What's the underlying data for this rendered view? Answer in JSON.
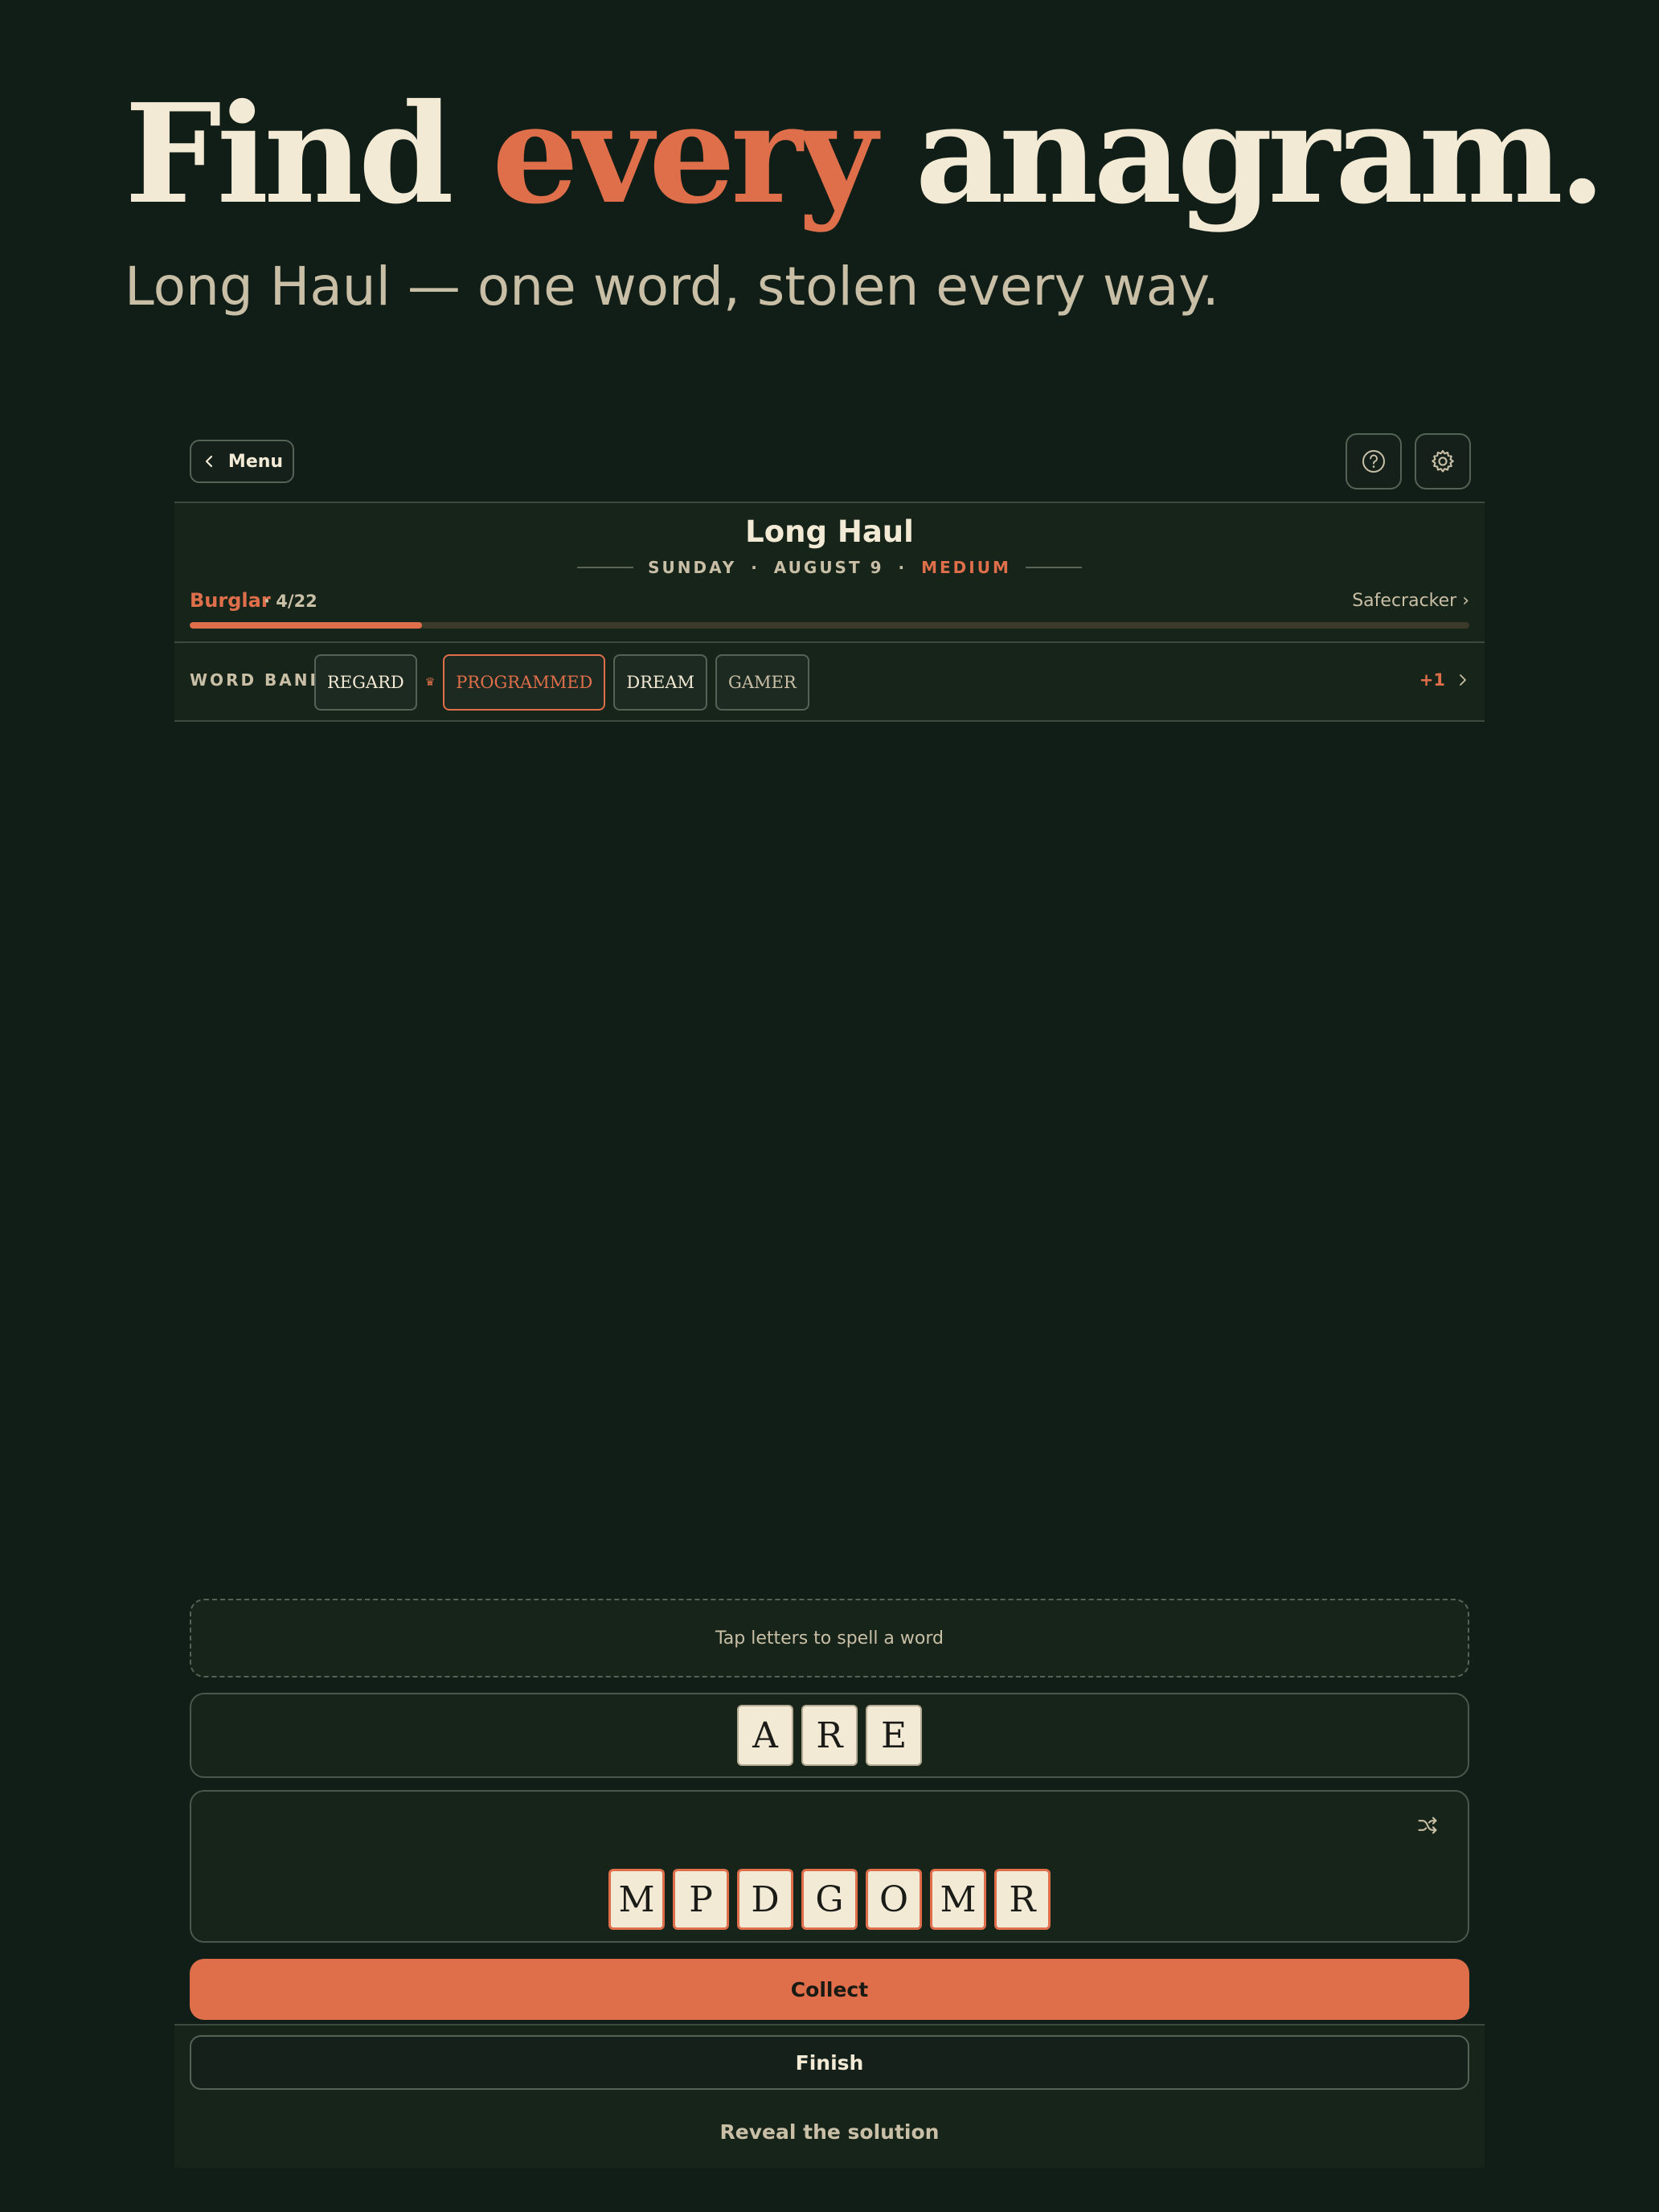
{
  "hero": {
    "title_start": "Find",
    "title_accent": "every",
    "title_end": "anagram.",
    "subtitle": "Long Haul — one word, stolen every way."
  },
  "topbar": {
    "menu_label": "Menu",
    "icons": [
      "chevron-left-icon",
      "help-circle-icon",
      "gear-icon"
    ]
  },
  "puzzle": {
    "title": "Long Haul",
    "day": "SUNDAY",
    "date": "AUGUST 9",
    "difficulty": "MEDIUM",
    "rank": "Burglar",
    "count": "· 4/22",
    "found": 4,
    "total": 22,
    "next_rank": "Safecracker ›"
  },
  "word_bank": {
    "label": "WORD BANK",
    "words": [
      "REGARD",
      "PROGRAMMED",
      "DREAM",
      "GAMER"
    ],
    "longest_marker": "♛",
    "more": "+1"
  },
  "play": {
    "hint": "Tap letters to spell a word",
    "current_word": [
      "A",
      "R",
      "E"
    ],
    "rack": [
      "M",
      "P",
      "D",
      "G",
      "O",
      "M",
      "R"
    ]
  },
  "actions": {
    "collect": "Collect",
    "finish": "Finish",
    "reveal": "Reveal the solution"
  },
  "colors": {
    "background": "#111e17",
    "panel": "#172419",
    "accent": "#de6f4a",
    "cream": "#f3ead6",
    "muted": "#c9bfa6"
  }
}
